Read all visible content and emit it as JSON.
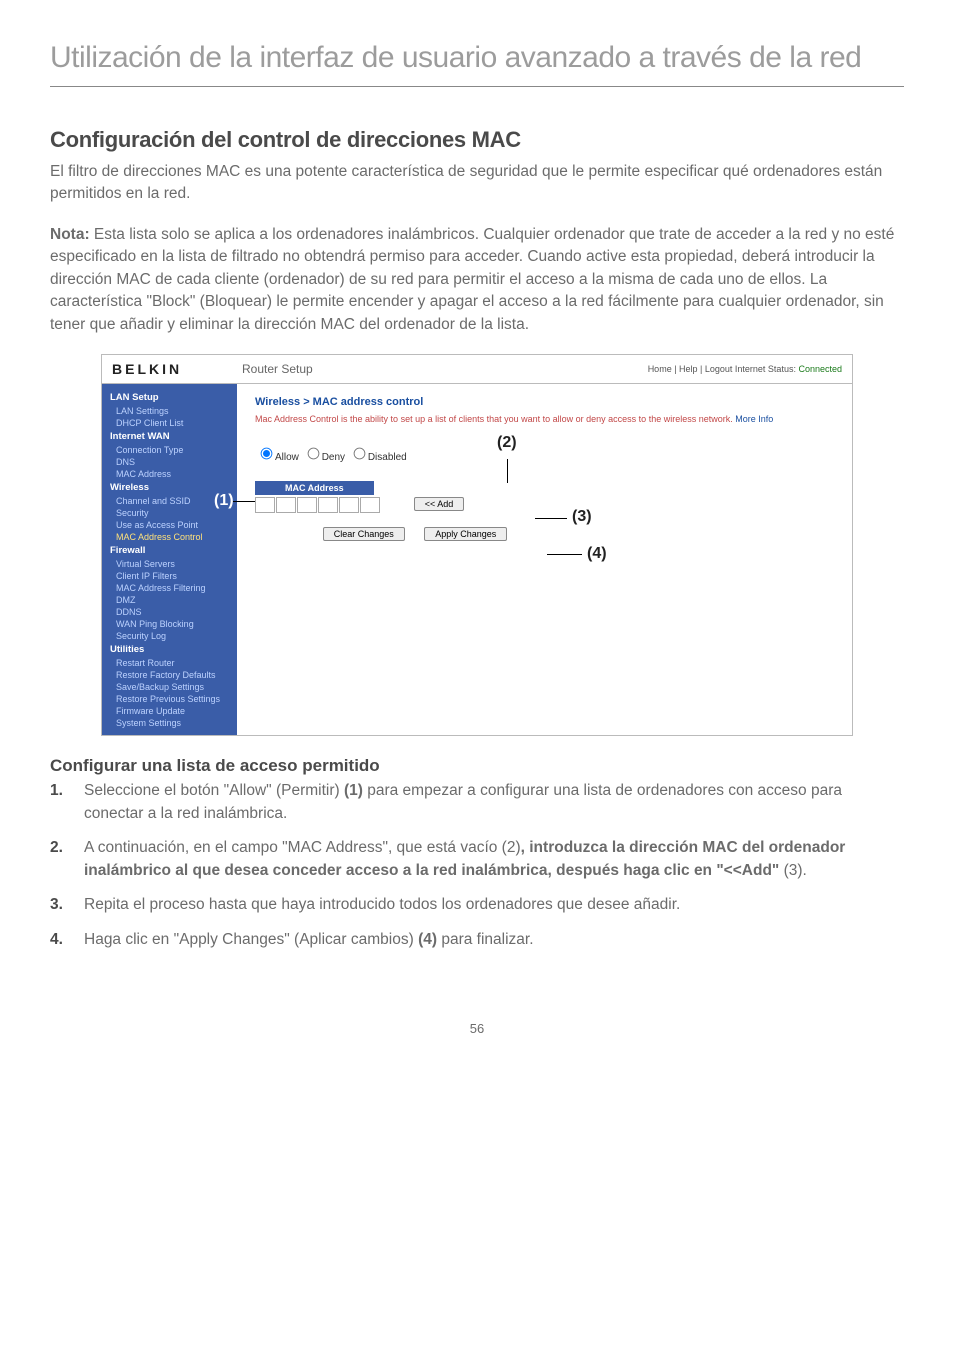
{
  "page_title": "Utilización de la interfaz de usuario avanzado a través de la red",
  "section_title": "Configuración del control de direcciones MAC",
  "intro": "El filtro de direcciones MAC es una potente característica de seguridad que le permite especificar qué ordenadores están permitidos en la red.",
  "note_label": "Nota:",
  "note_body": " Esta lista solo se aplica a los ordenadores inalámbricos. Cualquier ordenador que trate de acceder a la red y no esté especificado en la lista de filtrado no obtendrá permiso para acceder. Cuando active esta propiedad, deberá introducir la dirección MAC de cada cliente (ordenador) de su red para permitir el acceso a la misma de cada uno de ellos. La característica \"Block\" (Bloquear) le permite encender y apagar el acceso a la red fácilmente para cualquier ordenador, sin tener que añadir y eliminar la dirección MAC del ordenador de la lista.",
  "sub_title": "Configurar una lista de acceso permitido",
  "steps": {
    "s1a": "Seleccione el botón \"Allow\" (Permitir) ",
    "s1ref": "(1)",
    "s1b": " para empezar a configurar una lista de ordenadores con acceso para conectar a la red inalámbrica.",
    "s2a": " A continuación, en el campo \"MAC Address\", que está vacío (2)",
    "s2bold": ", introduzca la dirección MAC del ordenador inalámbrico al que desea conceder acceso a la red inalámbrica, después haga clic en \"<<Add\"",
    "s2c": " (3).",
    "s3": "Repita el proceso hasta que haya introducido todos los ordenadores que desee añadir.",
    "s4a": "Haga clic en \"Apply Changes\" (Aplicar cambios) ",
    "s4ref": "(4)",
    "s4b": " para finalizar."
  },
  "page_number": "56",
  "fig": {
    "brand": "BELKIN",
    "router": "Router Setup",
    "links": "Home | Help | Logout   Internet Status:",
    "status": " Connected",
    "side": {
      "cat1": "LAN Setup",
      "i1": "LAN Settings",
      "i2": "DHCP Client List",
      "cat2": "Internet WAN",
      "i3": "Connection Type",
      "i4": "DNS",
      "i5": "MAC Address",
      "cat3": "Wireless",
      "i6": "Channel and SSID",
      "i7": "Security",
      "i8": "Use as Access Point",
      "i9": "MAC Address Control",
      "cat4": "Firewall",
      "i10": "Virtual Servers",
      "i11": "Client IP Filters",
      "i12": "MAC Address Filtering",
      "i13": "DMZ",
      "i14": "DDNS",
      "i15": "WAN Ping Blocking",
      "i16": "Security Log",
      "cat5": "Utilities",
      "i17": "Restart Router",
      "i18": "Restore Factory Defaults",
      "i19": "Save/Backup Settings",
      "i20": "Restore Previous Settings",
      "i21": "Firmware Update",
      "i22": "System Settings"
    },
    "main": {
      "crumb": "Wireless > MAC address control",
      "desc": "Mac Address Control is the ability to set up a list of clients that you want to allow or deny access to the wireless network. ",
      "more": "More Info",
      "r_allow": "Allow",
      "r_deny": "Deny",
      "r_disabled": "Disabled",
      "th": "MAC Address",
      "add": "<< Add",
      "clear": "Clear Changes",
      "apply": "Apply Changes",
      "c1": "(1)",
      "c2": "(2)",
      "c3": "(3)",
      "c4": "(4)"
    }
  }
}
